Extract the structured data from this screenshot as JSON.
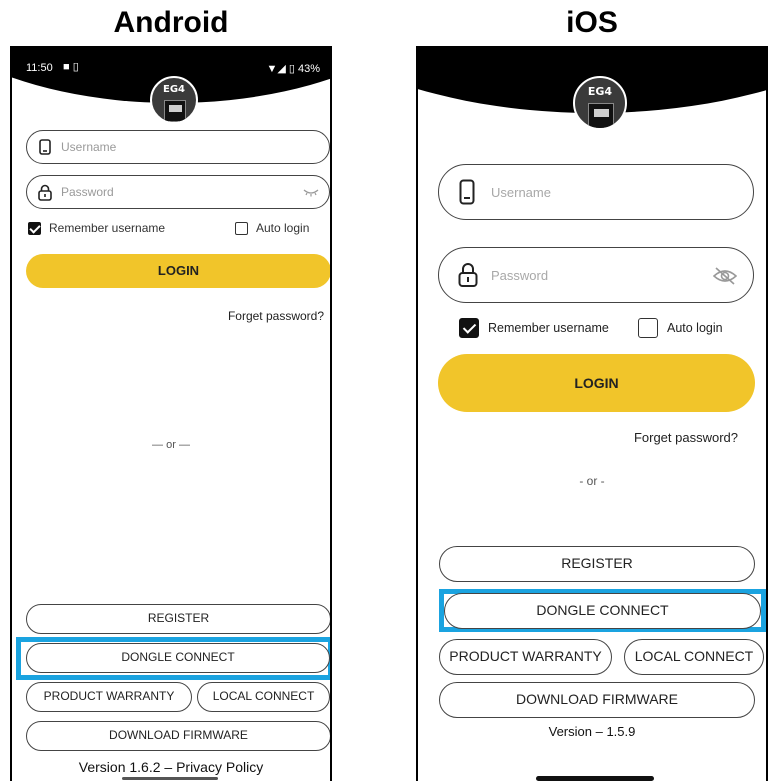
{
  "titles": {
    "android": "Android",
    "ios": "iOS"
  },
  "android": {
    "status": {
      "time": "11:50",
      "left_icons": "■ ▯",
      "right_icons": "▼◢ ▯ 43%"
    },
    "logo_text": "EG4",
    "username_placeholder": "Username",
    "password_placeholder": "Password",
    "remember_label": "Remember username",
    "remember_checked": true,
    "auto_login_label": "Auto login",
    "auto_login_checked": false,
    "login_label": "LOGIN",
    "forget_label": "Forget password?",
    "or_label": "— or —",
    "register_label": "REGISTER",
    "dongle_label": "DONGLE CONNECT",
    "warranty_label": "PRODUCT WARRANTY",
    "local_label": "LOCAL CONNECT",
    "firmware_label": "DOWNLOAD FIRMWARE",
    "version_label": "Version 1.6.2 – Privacy Policy"
  },
  "ios": {
    "logo_text": "EG4",
    "username_placeholder": "Username",
    "password_placeholder": "Password",
    "remember_label": "Remember username",
    "remember_checked": true,
    "auto_login_label": "Auto login",
    "auto_login_checked": false,
    "login_label": "LOGIN",
    "forget_label": "Forget password?",
    "or_label": "- or -",
    "register_label": "REGISTER",
    "dongle_label": "DONGLE CONNECT",
    "warranty_label": "PRODUCT WARRANTY",
    "local_label": "LOCAL CONNECT",
    "firmware_label": "DOWNLOAD FIRMWARE",
    "version_label": "Version – 1.5.9"
  },
  "colors": {
    "accent": "#f1c52a",
    "highlight": "#1aa3e0",
    "header": "#000000"
  },
  "icons": {
    "username": "phone-icon",
    "password": "padlock-icon",
    "reveal": "eye-slash-icon"
  }
}
